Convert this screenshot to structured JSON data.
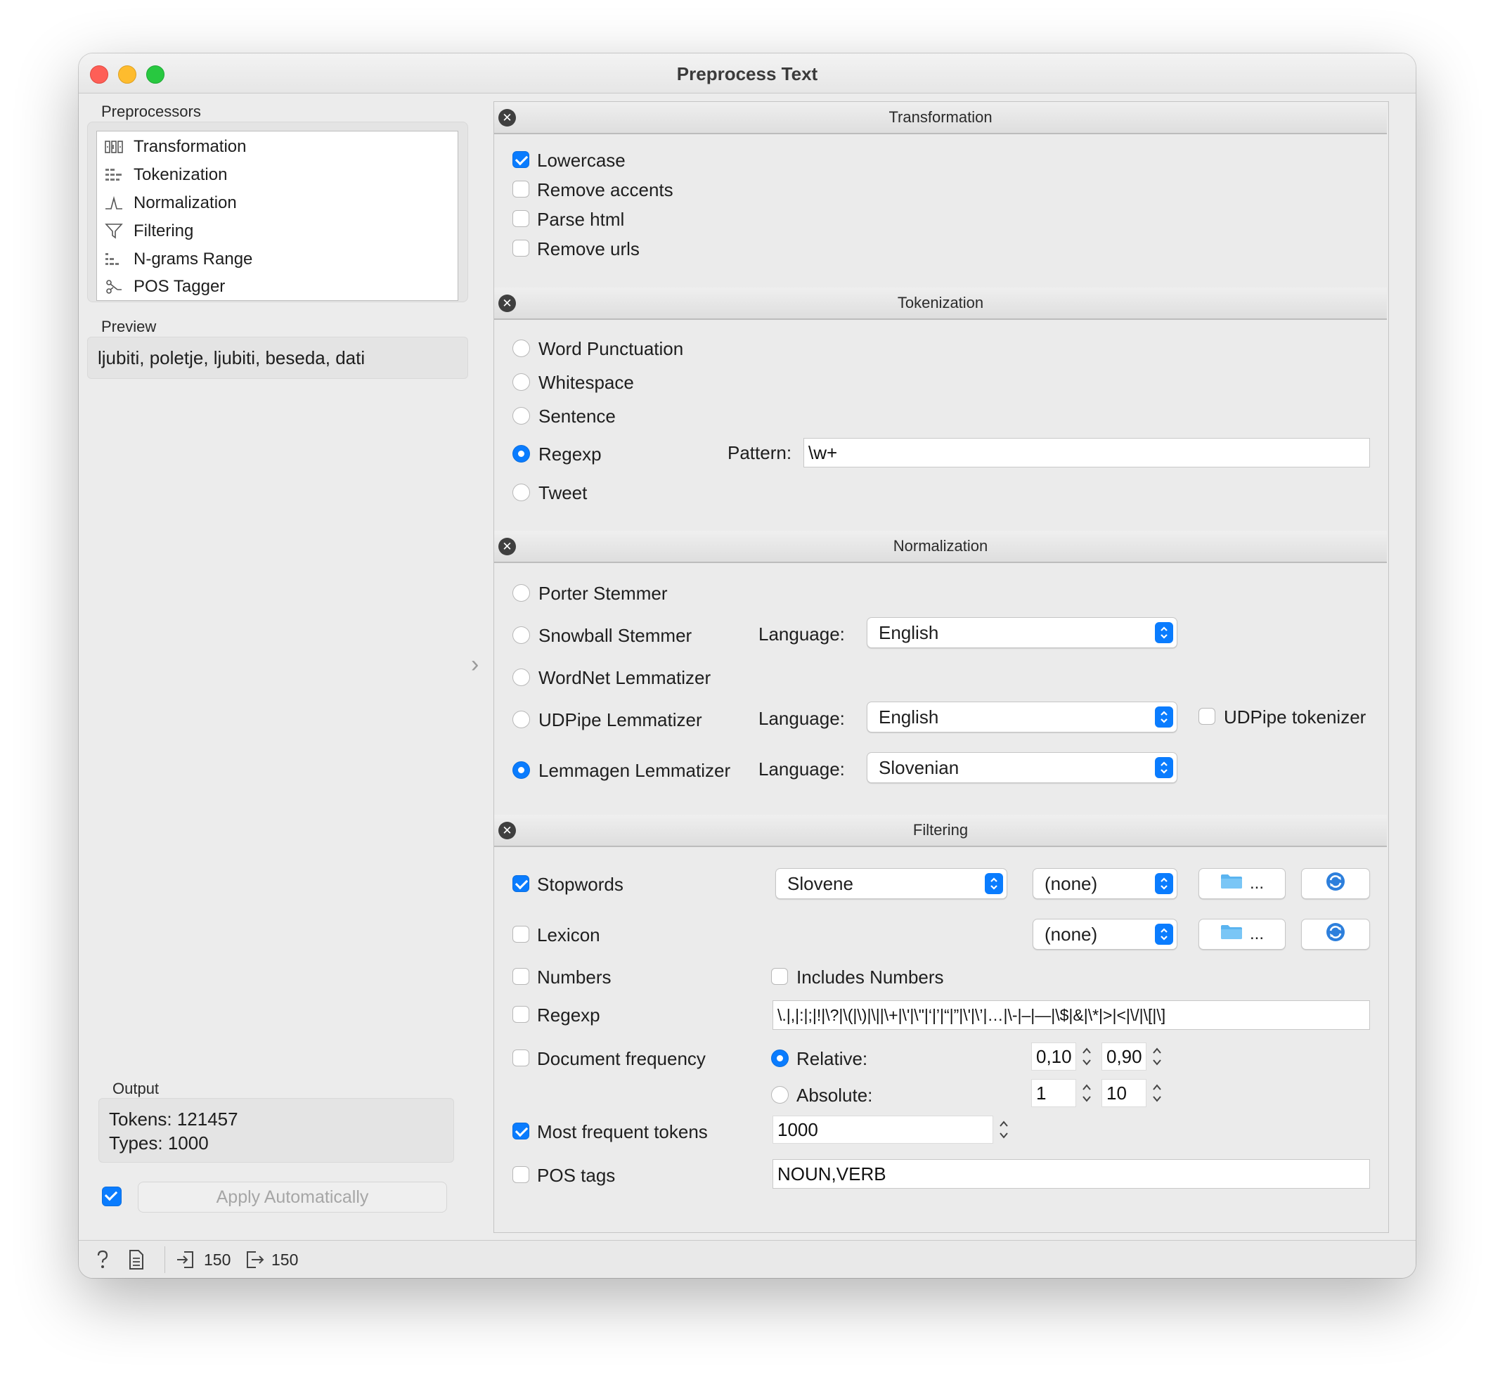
{
  "window": {
    "title": "Preprocess Text"
  },
  "left": {
    "preprocessors_label": "Preprocessors",
    "preprocessors": [
      {
        "label": "Transformation",
        "icon": "transformation-icon"
      },
      {
        "label": "Tokenization",
        "icon": "tokenization-icon"
      },
      {
        "label": "Normalization",
        "icon": "normalization-icon"
      },
      {
        "label": "Filtering",
        "icon": "filter-icon"
      },
      {
        "label": "N-grams Range",
        "icon": "ngrams-icon"
      },
      {
        "label": "POS Tagger",
        "icon": "pos-tagger-icon"
      }
    ],
    "preview_label": "Preview",
    "preview_text": "ljubiti, poletje, ljubiti, beseda, dati",
    "output_label": "Output",
    "tokens": "Tokens: 121457",
    "types": "Types: 1000",
    "apply_auto_checked": true,
    "apply_label": "Apply Automatically"
  },
  "transformation": {
    "title": "Transformation",
    "options": [
      {
        "label": "Lowercase",
        "checked": true
      },
      {
        "label": "Remove accents",
        "checked": false
      },
      {
        "label": "Parse html",
        "checked": false
      },
      {
        "label": "Remove urls",
        "checked": false
      }
    ]
  },
  "tokenization": {
    "title": "Tokenization",
    "options": [
      {
        "label": "Word  Punctuation",
        "selected": false
      },
      {
        "label": "Whitespace",
        "selected": false
      },
      {
        "label": "Sentence",
        "selected": false
      },
      {
        "label": "Regexp",
        "selected": true
      },
      {
        "label": "Tweet",
        "selected": false
      }
    ],
    "pattern_label": "Pattern:",
    "pattern_value": "\\w+"
  },
  "normalization": {
    "title": "Normalization",
    "options": [
      {
        "label": "Porter Stemmer",
        "selected": false
      },
      {
        "label": "Snowball Stemmer",
        "selected": false
      },
      {
        "label": "WordNet Lemmatizer",
        "selected": false
      },
      {
        "label": "UDPipe Lemmatizer",
        "selected": false
      },
      {
        "label": "Lemmagen Lemmatizer",
        "selected": true
      }
    ],
    "language_label": "Language:",
    "snowball_language": "English",
    "udpipe_language": "English",
    "lemmagen_language": "Slovenian",
    "udpipe_tokenizer_label": "UDPipe tokenizer",
    "udpipe_tokenizer_checked": false
  },
  "filtering": {
    "title": "Filtering",
    "stopwords": {
      "label": "Stopwords",
      "checked": true,
      "language": "Slovene",
      "file": "(none)"
    },
    "lexicon": {
      "label": "Lexicon",
      "checked": false,
      "file": "(none)"
    },
    "browse_label": "...",
    "numbers": {
      "label": "Numbers",
      "checked": false
    },
    "includes_numbers": {
      "label": "Includes Numbers",
      "checked": false
    },
    "regexp": {
      "label": "Regexp",
      "checked": false,
      "value": "\\.|,|:|;|!|\\?|\\(|\\)|\\||\\+|\\'|\\\"|‘|’|“|”|\\'|\\’|…|\\-|–|—|\\$|&|\\*|>|<|\\/|\\[|\\]"
    },
    "doc_freq": {
      "label": "Document frequency",
      "checked": false
    },
    "relative": {
      "label": "Relative:",
      "selected": true,
      "min": "0,10",
      "max": "0,90"
    },
    "absolute": {
      "label": "Absolute:",
      "selected": false,
      "min": "1",
      "max": "10"
    },
    "most_frequent": {
      "label": "Most frequent tokens",
      "checked": true,
      "value": "1000"
    },
    "pos_tags": {
      "label": "POS tags",
      "checked": false,
      "value": "NOUN,VERB"
    }
  },
  "statusbar": {
    "input_count": "150",
    "output_count": "150"
  },
  "colors": {
    "accent": "#0a7cfe",
    "close": "#fe5f57",
    "minimize": "#febc2e",
    "maximize": "#28c840"
  }
}
